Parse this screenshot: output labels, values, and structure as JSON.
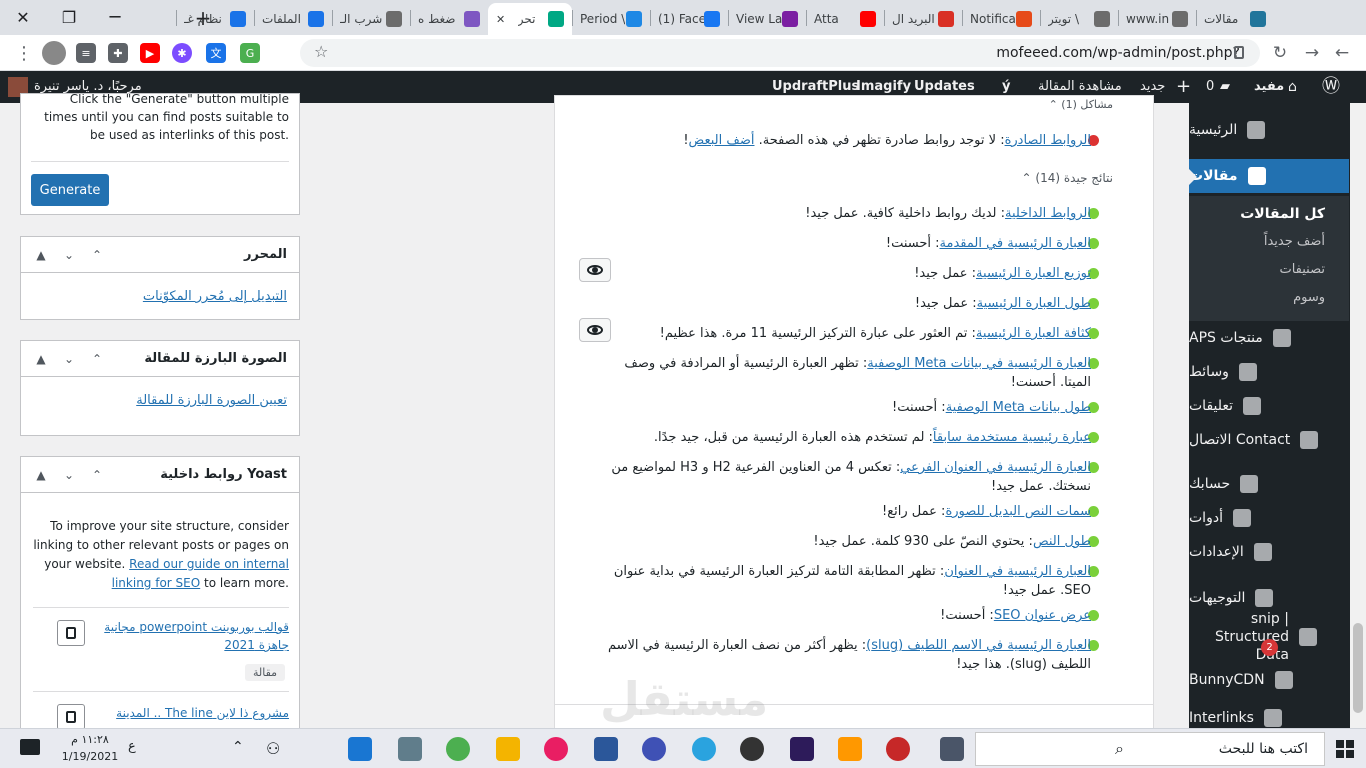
{
  "browser": {
    "tabs": [
      {
        "title": "مقالات",
        "color": "#21759b"
      },
      {
        "title": "www.in",
        "color": "#6c6c6c"
      },
      {
        "title": "تويتر \\",
        "color": "#6c6c6c"
      },
      {
        "title": "Notifica",
        "color": "#e64a19"
      },
      {
        "title": "البريد ال",
        "color": "#d93025"
      },
      {
        "title": "Atta",
        "color": "#ff0000"
      },
      {
        "title": "View La",
        "color": "#7b1fa2"
      },
      {
        "title": "(1) Face",
        "color": "#1877f2"
      },
      {
        "title": "Period \\",
        "color": "#1e88e5"
      },
      {
        "title": "تحر",
        "color": "#00a884",
        "active": true
      },
      {
        "title": "ضغط ه",
        "color": "#7e57c2"
      },
      {
        "title": "شرب الـ",
        "color": "#6c6c6c"
      },
      {
        "title": "الملفات",
        "color": "#1a73e8"
      },
      {
        "title": "نظام غـ",
        "color": "#1a73e8"
      }
    ],
    "url": "mofeeed.com/wp-admin/post.php?post=10625&action=edit"
  },
  "adminbar": {
    "site": "مفيد",
    "comments": "0",
    "new": "جديد",
    "view_post": "مشاهدة المقالة",
    "updates": "Updates",
    "imagify": "Imagify",
    "updraft": "UpdraftPlus",
    "greeting": "مرحبًا، د. ياسر تنيرة"
  },
  "menu": {
    "items": [
      {
        "label": "الرئيسية"
      },
      {
        "label": "مقالات",
        "current": true
      },
      {
        "label": "منتجات APS"
      },
      {
        "label": "وسائط"
      },
      {
        "label": "تعليقات"
      },
      {
        "label": "Contact الاتصال"
      },
      {
        "label": "حسابك"
      },
      {
        "label": "أدوات"
      },
      {
        "label": "الإعدادات"
      },
      {
        "label": "التوجيهات"
      },
      {
        "label": "snip | Structured Data",
        "badge": "2"
      },
      {
        "label": "BunnyCDN"
      },
      {
        "label": "Interlinks"
      }
    ],
    "submenu": [
      {
        "label": "كل المقالات",
        "current": true
      },
      {
        "label": "أضف جديداً"
      },
      {
        "label": "تصنيفات"
      },
      {
        "label": "وسوم"
      }
    ]
  },
  "analysis": {
    "problems_header": "مشاكل (1)",
    "problem": {
      "link": "الروابط الصادرة",
      "text": ": لا توجد روابط صادرة تظهر في هذه الصفحة. ",
      "action": "أضف البعض",
      "end": "!"
    },
    "good_header": "نتائج جيدة (14)",
    "good": [
      {
        "link": "الروابط الداخلية",
        "text": ": لديك روابط داخلية كافية. عمل جيد!"
      },
      {
        "link": "العبارة الرئيسية في المقدمة",
        "text": ": أحسنت!"
      },
      {
        "link": "توزيع العبارة الرئيسية",
        "text": ": عمل جيد!",
        "eye": true
      },
      {
        "link": "طول العبارة الرئيسية",
        "text": ": عمل جيد!"
      },
      {
        "link": "كثافة العبارة الرئيسية",
        "text": ": تم العثور على عبارة التركيز الرئيسية 11 مرة. هذا عظيم!",
        "eye": true
      },
      {
        "link": "العبارة الرئيسية في بيانات Meta الوصفية",
        "text": ": تظهر العبارة الرئيسية أو المرادفة في وصف الميتا. أحسنت!"
      },
      {
        "link": "طول بيانات Meta الوصفية",
        "text": ": أحسنت!"
      },
      {
        "link": "عبارة رئيسية مستخدمة سابقاً",
        "text": ": لم تستخدم هذه العبارة الرئيسية من قبل، جيد جدًا."
      },
      {
        "link": "العبارة الرئيسية في العنوان الفرعي",
        "text": ": تعكس 4 من العناوين الفرعية H2 و H3 لمواضيع من نسختك. عمل جيد!"
      },
      {
        "link": "سمات النص البديل للصورة",
        "text": ": عمل رائع!"
      },
      {
        "link": "طول النص",
        "text": ": يحتوي النصّ على 930 كلمة. عمل جيد!"
      },
      {
        "link": "العبارة الرئيسية في العنوان",
        "text": ": تظهر المطابقة التامة لتركيز العبارة الرئيسية في بداية عنوان SEO. عمل جيد!"
      },
      {
        "link": "عرض عنوان SEO",
        "text": ": أحسنت!"
      },
      {
        "link": "العبارة الرئيسية في الاسم اللطيف (slug)",
        "text": ": يظهر أكثر من نصف العبارة الرئيسية في الاسم اللطيف (slug). هذا جيد!"
      }
    ]
  },
  "left": {
    "interlinks_text": "Click the \"Generate\" button multiple times until you can find posts suitable to be used as interlinks of this post.",
    "generate": "Generate",
    "editor_title": "المحرر",
    "editor_link": "التبديل إلى مُحرر المكوّنات",
    "featured_title": "الصورة البارزة للمقالة",
    "featured_link": "تعيين الصورة البارزة للمقالة",
    "yoast_title": "Yoast روابط داخلية",
    "yoast_text": "To improve your site structure, consider linking to other relevant posts or pages on your website.",
    "yoast_guide": "Read our guide on internal linking for SEO",
    "yoast_end": " to learn more.",
    "related": [
      {
        "title": "قوالب بوربوينت powerpoint مجانية جاهزة 2021",
        "tag": "مقالة"
      },
      {
        "title": "مشروع ذا لاين The line .. المدينة"
      }
    ]
  },
  "taskbar": {
    "search_placeholder": "اكتب هنا للبحث",
    "time": "١١:٢٨ م",
    "date": "1/19/2021",
    "lang": "ع"
  },
  "watermark": "مستقل"
}
